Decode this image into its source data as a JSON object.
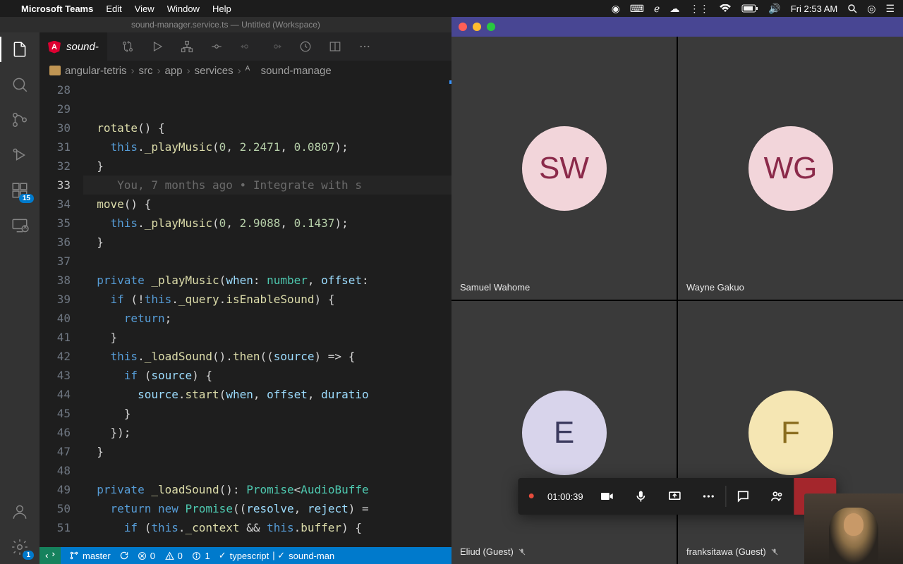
{
  "menubar": {
    "app": "Microsoft Teams",
    "items": [
      "Edit",
      "View",
      "Window",
      "Help"
    ],
    "clock": "Fri 2:53 AM"
  },
  "vscode": {
    "title": "sound-manager.service.ts — Untitled (Workspace)",
    "tab": {
      "name": "sound-"
    },
    "extensions_badge": "15",
    "settings_badge": "1",
    "breadcrumb": [
      "angular-tetris",
      "src",
      "app",
      "services",
      "sound-manage"
    ],
    "gutter_start": 28,
    "code_lines": [
      "",
      "",
      "  rotate() {",
      "    this._playMusic(0, 2.2471, 0.0807);",
      "  }",
      "     You, 7 months ago • Integrate with s",
      "  move() {",
      "    this._playMusic(0, 2.9088, 0.1437);",
      "  }",
      "",
      "  private _playMusic(when: number, offset:",
      "    if (!this._query.isEnableSound) {",
      "      return;",
      "    }",
      "    this._loadSound().then((source) => {",
      "      if (source) {",
      "        source.start(when, offset, duratio",
      "      }",
      "    });",
      "  }",
      "",
      "  private _loadSound(): Promise<AudioBuffe",
      "    return new Promise((resolve, reject) =",
      "      if (this._context && this.buffer) {"
    ],
    "status": {
      "branch": "master",
      "errors": "0",
      "warnings": "0",
      "info": "1",
      "lang": "typescript",
      "lint": "sound-man"
    }
  },
  "teams": {
    "participants": [
      {
        "initials": "SW",
        "name": "Samuel Wahome",
        "bg": "#f2d5da",
        "fg": "#8b2a4a",
        "muted": false
      },
      {
        "initials": "WG",
        "name": "Wayne Gakuo",
        "bg": "#f2d5da",
        "fg": "#8b2a4a",
        "muted": false
      },
      {
        "initials": "E",
        "name": "Eliud (Guest)",
        "bg": "#d8d4eb",
        "fg": "#3b3a5e",
        "muted": true
      },
      {
        "initials": "F",
        "name": "franksitawa (Guest)",
        "bg": "#f5e6b3",
        "fg": "#8a6d1e",
        "muted": true
      }
    ],
    "duration": "01:00:39"
  }
}
